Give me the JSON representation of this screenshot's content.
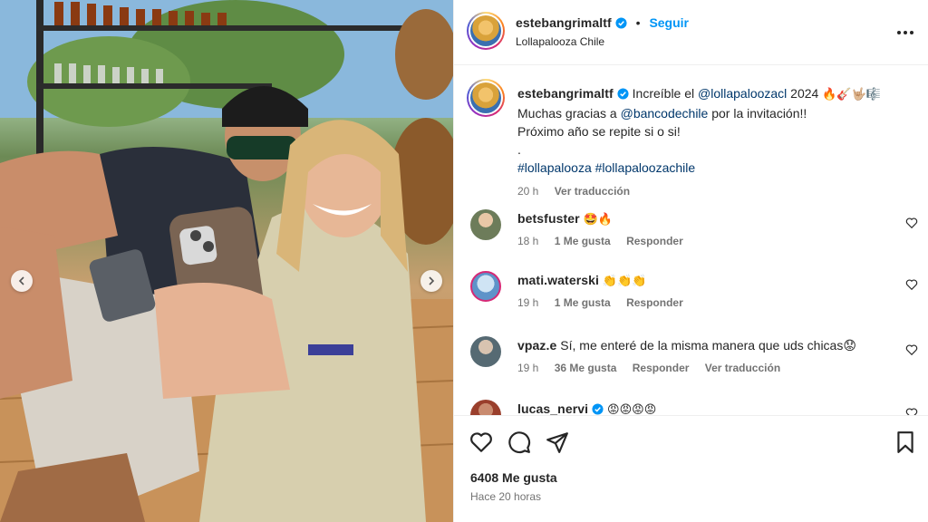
{
  "post": {
    "author": "estebangrimaltf",
    "follow_label": "Seguir",
    "separator": "•",
    "location": "Lollapalooza Chile"
  },
  "caption": {
    "author": "estebangrimaltf",
    "line1_pre": "Increíble el ",
    "mention1": "@lollapaloozacl",
    "line1_post": " 2024 ",
    "line1_emoji": "🔥🎸🤟🏼🎼",
    "line2_pre": "Muchas gracias a ",
    "mention2": "@bancodechile",
    "line2_post": " por la invitación!!",
    "line3": "Próximo año se repite si o si!",
    "line4": ".",
    "hashtag1": "#lollapalooza",
    "hashtag2": "#lollapaloozachile",
    "time": "20 h",
    "translate": "Ver traducción"
  },
  "comments": [
    {
      "user": "betsfuster",
      "text": "🤩🔥",
      "time": "18 h",
      "likes": "1 Me gusta",
      "reply": "Responder",
      "translate": ""
    },
    {
      "user": "mati.waterski",
      "text": "👏👏👏",
      "time": "19 h",
      "likes": "1 Me gusta",
      "reply": "Responder",
      "translate": ""
    },
    {
      "user": "vpaz.e",
      "text": "Sí, me enteré de la misma manera que uds chicas😟",
      "time": "19 h",
      "likes": "36 Me gusta",
      "reply": "Responder",
      "translate": "Ver traducción"
    },
    {
      "user": "lucas_nervi",
      "text": "😡😡😡😡",
      "time": "",
      "likes": "",
      "reply": "",
      "translate": ""
    }
  ],
  "actions": {
    "likes_count": "6408 Me gusta",
    "posted_ago": "Hace 20 horas"
  },
  "icons": {
    "more": "more-horizontal-icon",
    "like": "heart-icon",
    "comment": "comment-bubble-icon",
    "share": "paper-plane-icon",
    "save": "bookmark-icon",
    "verified": "verified-badge-icon",
    "prev": "chevron-left-icon",
    "next": "chevron-right-icon"
  },
  "colors": {
    "accent_blue": "#0095f6",
    "mention": "#00376b",
    "meta_gray": "#737373"
  }
}
